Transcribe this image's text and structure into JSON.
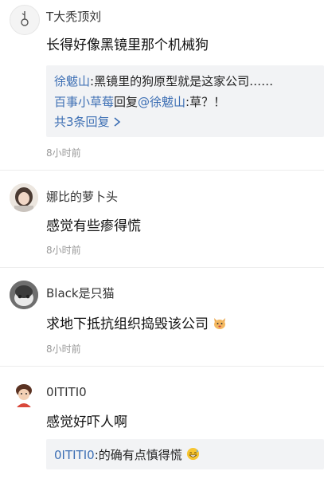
{
  "comments": [
    {
      "username": "T大秃顶刘",
      "content": "长得好像黑镜里那个机械狗",
      "time": "8小时前",
      "replies": [
        {
          "author": "徐魃山",
          "sep": ":",
          "text": "黑镜里的狗原型就是这家公司……"
        },
        {
          "author": "百事小草莓",
          "mid": "回复",
          "target": "@徐魃山",
          "sep": ":",
          "text": "草？！"
        }
      ],
      "more_replies": "共3条回复",
      "more_icon": "chevron-right-icon"
    },
    {
      "username": "娜比的萝卜头",
      "content": "感觉有些瘆得慌",
      "time": "8小时前"
    },
    {
      "username": "Black是只猫",
      "content": "求地下抵抗组织捣毁该公司",
      "content_emoji": "cat-face-emoji",
      "time": "8小时前"
    },
    {
      "username": "0ITITI0",
      "content": "感觉好吓人啊",
      "replies": [
        {
          "author": "0ITITI0",
          "sep": ":",
          "text": "的确有点慎得慌",
          "emoji": "grinning-sweat-emoji"
        }
      ]
    }
  ],
  "colors": {
    "link": "#3d6fb4",
    "reply_bg": "#f2f3f5",
    "time": "#9a9a9a"
  }
}
